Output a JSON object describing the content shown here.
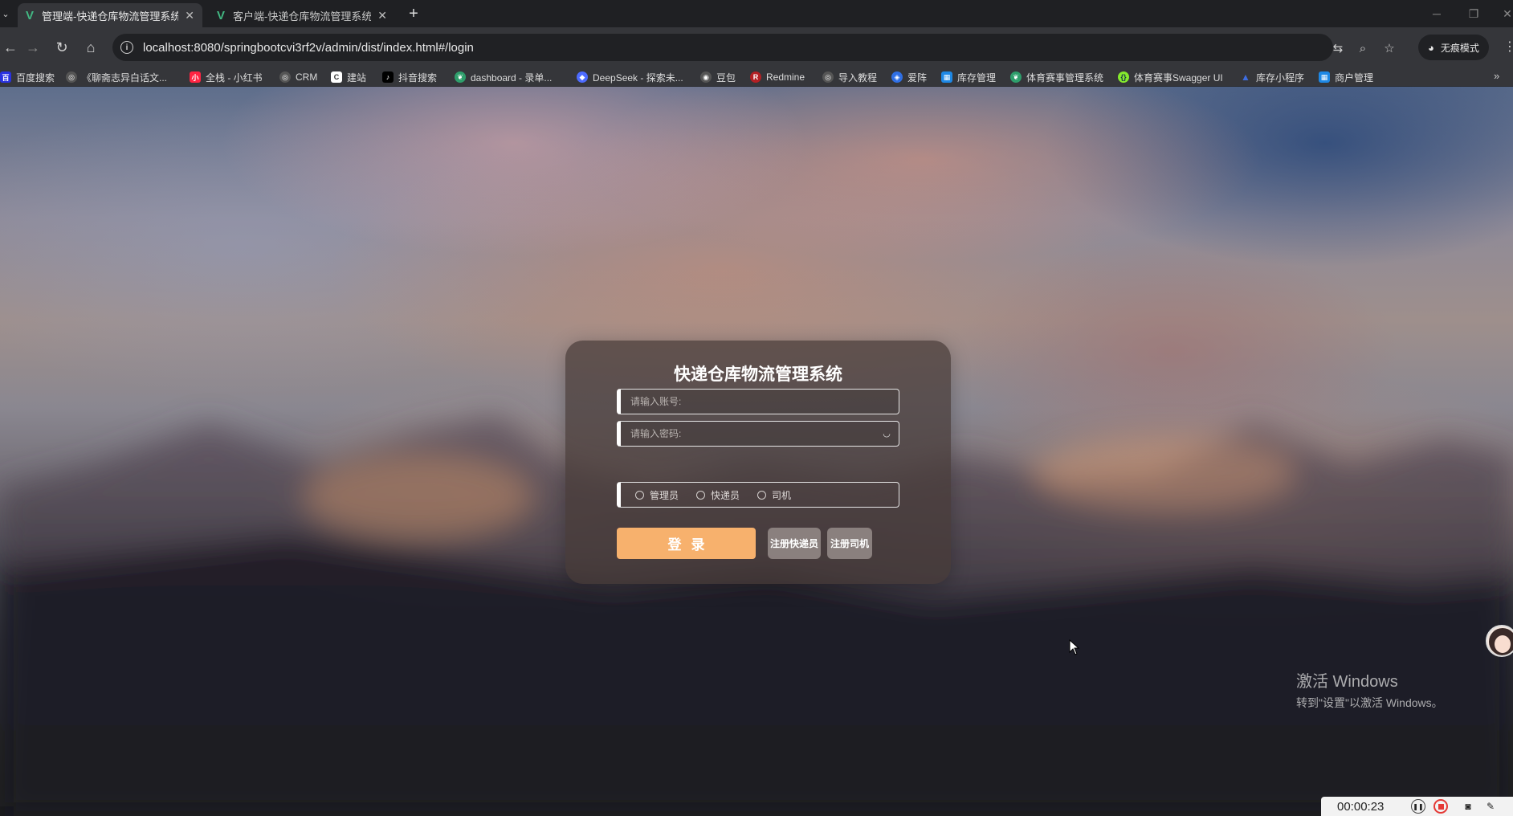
{
  "browser": {
    "tabs": [
      {
        "title": "管理端-快递仓库物流管理系统",
        "active": true
      },
      {
        "title": "客户端-快递仓库物流管理系统",
        "active": false
      }
    ],
    "url": "localhost:8080/springbootcvi3rf2v/admin/dist/index.html#/login",
    "incognito_label": "无痕模式",
    "bookmarks": [
      {
        "label": "百度搜索",
        "icon": "baidu-icon",
        "color": "#2932e1"
      },
      {
        "label": "《聊斋志异白话文...",
        "icon": "globe-icon",
        "color": "#555"
      },
      {
        "label": "全栈 - 小红书",
        "icon": "xiaohongshu-icon",
        "color": "#ff2442"
      },
      {
        "label": "CRM",
        "icon": "globe-icon",
        "color": "#555"
      },
      {
        "label": "建站",
        "icon": "site-icon",
        "color": "#ffffff"
      },
      {
        "label": "抖音搜索",
        "icon": "douyin-icon",
        "color": "#000000"
      },
      {
        "label": "dashboard - 录单...",
        "icon": "leaf-icon",
        "color": "#2e9e6b"
      },
      {
        "label": "DeepSeek - 探索未...",
        "icon": "deepseek-icon",
        "color": "#4d6bfe"
      },
      {
        "label": "豆包",
        "icon": "doubao-icon",
        "color": "#555"
      },
      {
        "label": "Redmine",
        "icon": "redmine-icon",
        "color": "#b32024"
      },
      {
        "label": "导入教程",
        "icon": "globe-icon",
        "color": "#555"
      },
      {
        "label": "爱阵",
        "icon": "shield-icon",
        "color": "#2f6fe4"
      },
      {
        "label": "库存管理",
        "icon": "grid-icon",
        "color": "#1e88e5"
      },
      {
        "label": "体育赛事管理系统",
        "icon": "leaf-icon",
        "color": "#2e9e6b"
      },
      {
        "label": "体育赛事Swagger UI",
        "icon": "swagger-icon",
        "color": "#85ea2d"
      },
      {
        "label": "库存小程序",
        "icon": "triangle-icon",
        "color": "#3d6de0"
      },
      {
        "label": "商户管理",
        "icon": "grid-icon",
        "color": "#1e88e5"
      }
    ]
  },
  "login": {
    "title": "快递仓库物流管理系统",
    "account_placeholder": "请输入账号:",
    "password_placeholder": "请输入密码:",
    "roles": [
      "管理员",
      "快递员",
      "司机"
    ],
    "login_label": "登录",
    "register_courier_label": "注册快递员",
    "register_driver_label": "注册司机"
  },
  "system": {
    "watermark_title": "激活 Windows",
    "watermark_subtitle": "转到\"设置\"以激活 Windows。",
    "recorder_time": "00:00:23"
  }
}
